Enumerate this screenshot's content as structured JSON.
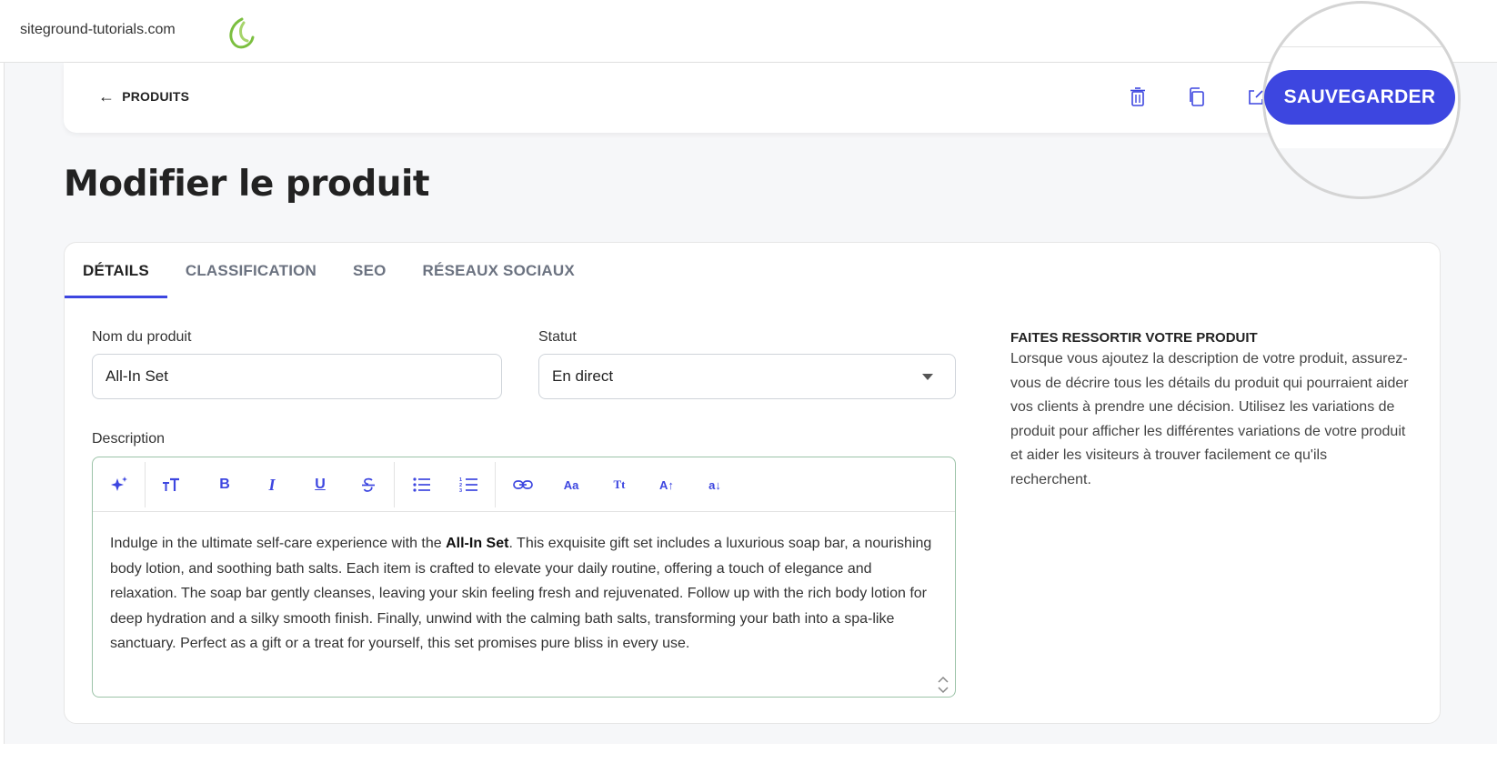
{
  "topbar": {
    "site_name": "siteground-tutorials.com",
    "logo_icon": "siteground-logo-icon"
  },
  "actionbar": {
    "back_label": "PRODUITS",
    "back_icon": "arrow-left-icon",
    "icons": [
      "trash-icon",
      "duplicate-icon",
      "external-link-icon"
    ],
    "save_label": "SAUVEGARDER"
  },
  "page": {
    "title": "Modifier le produit"
  },
  "tabs": [
    {
      "label": "DÉTAILS",
      "active": true
    },
    {
      "label": "CLASSIFICATION",
      "active": false
    },
    {
      "label": "SEO",
      "active": false
    },
    {
      "label": "RÉSEAUX SOCIAUX",
      "active": false
    }
  ],
  "form": {
    "name_label": "Nom du produit",
    "name_value": "All-In Set",
    "status_label": "Statut",
    "status_value": "En direct",
    "description_label": "Description",
    "description": {
      "before": "Indulge in the ultimate self-care experience with the ",
      "bold": "All-In Set",
      "after": ". This exquisite gift set includes a luxurious soap bar, a nourishing body lotion, and soothing bath salts. Each item is crafted to elevate your daily routine, offering a touch of elegance and relaxation. The soap bar gently cleanses, leaving your skin feeling fresh and rejuvenated. Follow up with the rich body lotion for deep hydration and a silky smooth finish. Finally, unwind with the calming bath salts, transforming your bath into a spa-like sanctuary. Perfect as a gift or a treat for yourself, this set promises pure bliss in every use."
    }
  },
  "toolbar": {
    "bold": "B",
    "italic": "I",
    "underline": "U",
    "font_case": "Aa",
    "title_case": "Tt",
    "uppercase": "A↑",
    "lowercase": "a↓"
  },
  "help": {
    "title": "FAITES RESSORTIR VOTRE PRODUIT",
    "text": "Lorsque vous ajoutez la description de votre produit, assurez-vous de décrire tous les détails du produit qui pourraient aider vos clients à prendre une décision. Utilisez les variations de produit pour afficher les différentes variations de votre produit et aider les visiteurs à trouver facilement ce qu'ils recherchent."
  },
  "colors": {
    "accent": "#3d46e0",
    "background": "#f6f7f9"
  }
}
